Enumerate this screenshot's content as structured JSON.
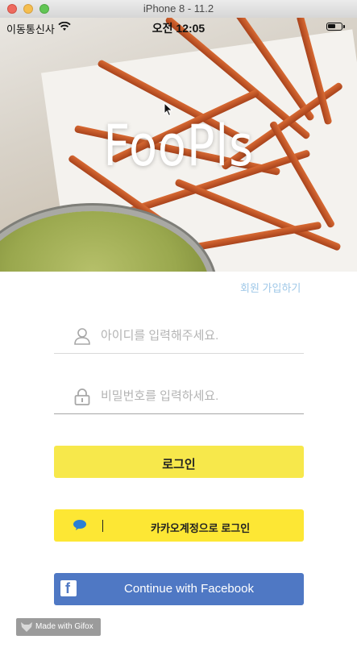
{
  "window": {
    "title": "iPhone 8 - 11.2"
  },
  "status_bar": {
    "carrier": "이동통신사",
    "time": "오전 12:05",
    "battery_level": 0.5
  },
  "hero": {
    "app_name": "FooPls"
  },
  "signup_link": "회원 가입하기",
  "id_field": {
    "placeholder": "아이디를 입력해주세요.",
    "value": ""
  },
  "password_field": {
    "placeholder": "비밀번호를 입력하세요.",
    "value": ""
  },
  "buttons": {
    "login": "로그인",
    "kakao": "카카오계정으로 로그인",
    "facebook": "Continue with Facebook"
  },
  "watermark": {
    "text": "Made with Gifox"
  },
  "colors": {
    "login_yellow": "#f7e84b",
    "kakao_yellow": "#fde734",
    "facebook_blue": "#4f78c4",
    "signup_link": "#9fc8e8",
    "kakao_bubble": "#2a7fd4"
  },
  "icons": {
    "wifi": "wifi-icon",
    "battery": "battery-icon",
    "id": "user-icon",
    "password": "lock-icon",
    "kakao": "speech-bubble-icon",
    "facebook": "facebook-icon",
    "cursor": "mouse-pointer-icon"
  }
}
